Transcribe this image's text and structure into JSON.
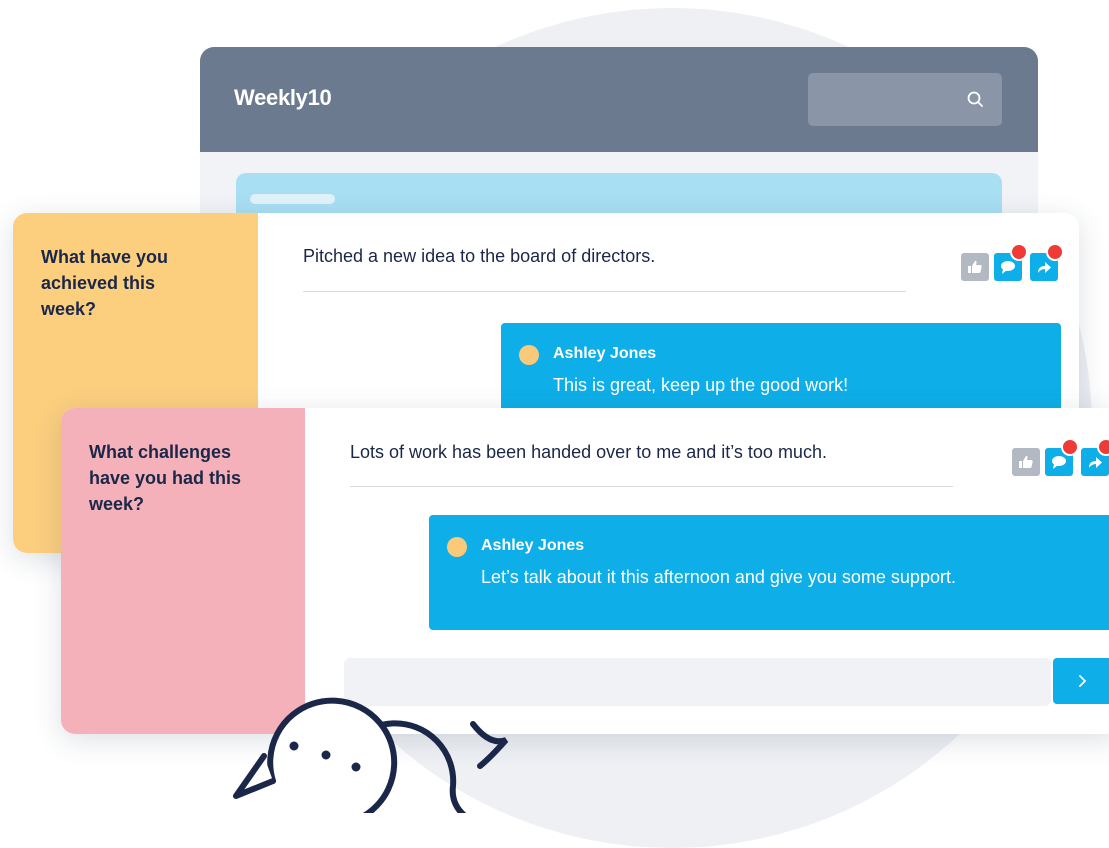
{
  "app": {
    "logo_text": "Weekly10",
    "search_icon": "search-icon"
  },
  "questions": [
    {
      "question": "What have you achieved this week?",
      "answer": "Pitched a new idea to the board of directors.",
      "panel_color": "#fccf7f",
      "actions": [
        "thumbs-up-icon",
        "comment-icon",
        "share-icon"
      ],
      "reply": {
        "author": "Ashley Jones",
        "text": "This is great, keep up the good work!"
      }
    },
    {
      "question": "What challenges have you had this week?",
      "answer": "Lots of work has been handed over to me and it’s too much.",
      "panel_color": "#f5b1ba",
      "actions": [
        "thumbs-up-icon",
        "comment-icon",
        "share-icon"
      ],
      "reply": {
        "author": "Ashley Jones",
        "text": "Let’s talk about it this afternoon and give you some support."
      }
    }
  ],
  "comment_box": {
    "placeholder": "",
    "send_icon": "chevron-right-icon"
  },
  "colors": {
    "header": "#6c7a90",
    "accent_blue": "#0eaee8",
    "notification_red": "#ef3b36",
    "avatar_yellow": "#fbc97a"
  },
  "decoration_icon": "chat-bubbles-icon"
}
